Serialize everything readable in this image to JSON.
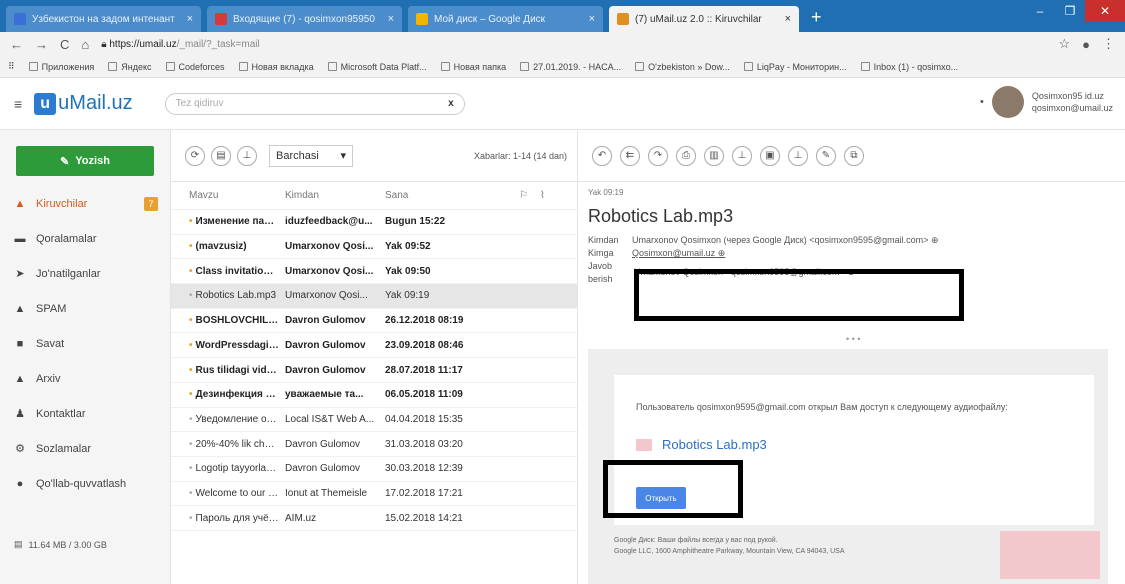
{
  "browser": {
    "tabs": [
      {
        "title": "Ўзбекистон на задом интенант",
        "color": "#3a6fd8"
      },
      {
        "title": "Входящие (7) - qosimxon95950",
        "color": "#d43a3a"
      },
      {
        "title": "Мой диск – Google Диск",
        "color": "#f2b600"
      },
      {
        "title": "(7) uMail.uz 2.0 :: Kiruvchilar",
        "color": "#e09020"
      }
    ],
    "new_tab": "+",
    "url_domain": "https://umail.uz",
    "url_path": "/_mail/?_task=mail",
    "bookmarks": [
      "Приложения",
      "Яндекс",
      "Codeforces",
      "Новая вкладка",
      "Microsoft Data Platf...",
      "Новая папка",
      "27.01.2019. - HACA...",
      "O'zbekiston » Dow...",
      "LiqPay - Мониторин...",
      "Inbox (1) - qosimxo..."
    ]
  },
  "app": {
    "logo_text": "uMail.uz",
    "logo_letter": "u",
    "search_placeholder": "Tez qidiruv",
    "search_clear": "x",
    "user": {
      "line1": "Qosimxon95 id.uz",
      "line2": "qosimxon@umail.uz"
    }
  },
  "sidebar": {
    "compose_label": "Yozish",
    "items": [
      {
        "label": "Kiruvchilar",
        "icon": "inbox-icon",
        "glyph": "▲",
        "badge": "7"
      },
      {
        "label": "Qoralamalar",
        "icon": "drafts-icon",
        "glyph": "▬"
      },
      {
        "label": "Jo'natilganlar",
        "icon": "sent-icon",
        "glyph": "➤"
      },
      {
        "label": "SPAM",
        "icon": "spam-icon",
        "glyph": "▲"
      },
      {
        "label": "Savat",
        "icon": "trash-icon",
        "glyph": "■"
      },
      {
        "label": "Arxiv",
        "icon": "archive-icon",
        "glyph": "▲"
      },
      {
        "label": "Kontaktlar",
        "icon": "contacts-icon",
        "glyph": "♟"
      },
      {
        "label": "Sozlamalar",
        "icon": "settings-icon",
        "glyph": "⚙"
      },
      {
        "label": "Qo'llab-quvvatlash",
        "icon": "support-icon",
        "glyph": "●"
      }
    ],
    "quota": "11.64 MB / 3.00 GB"
  },
  "list": {
    "filter_value": "Barchasi",
    "count_text": "Xabarlar: 1-14 (14 dan)",
    "headers": {
      "subject": "Mavzu",
      "from": "Kimdan",
      "date": "Sana"
    },
    "rows": [
      {
        "subject": "Изменение пароля...",
        "from": "iduzfeedback@u...",
        "date": "Bugun 15:22",
        "unread": true
      },
      {
        "subject": "(mavzusiz)",
        "from": "Umarxonov Qosi...",
        "date": "Yak 09:52",
        "unread": true
      },
      {
        "subject": "Class invitation: \"K...",
        "from": "Umarxonov Qosi...",
        "date": "Yak 09:50",
        "unread": true
      },
      {
        "subject": "Robotics Lab.mp3",
        "from": "Umarxonov Qosi...",
        "date": "Yak 09:19",
        "unread": false,
        "selected": true
      },
      {
        "subject": "BOSHLOVCHILAR ...",
        "from": "Davron Gulomov",
        "date": "26.12.2018 08:19",
        "unread": true
      },
      {
        "subject": "WordPressdagi sa...",
        "from": "Davron Gulomov",
        "date": "23.09.2018 08:46",
        "unread": true
      },
      {
        "subject": "Rus tilidagi video k...",
        "from": "Davron Gulomov",
        "date": "28.07.2018 11:17",
        "unread": true
      },
      {
        "subject": "Дезинфекция в Т...",
        "from": "уважаемые та...",
        "date": "06.05.2018 11:09",
        "unread": true
      },
      {
        "subject": "Уведомление о п...",
        "from": "Local IS&T Web A...",
        "date": "04.04.2018 15:35",
        "unread": false
      },
      {
        "subject": "20%-40% lik chegir...",
        "from": "Davron Gulomov",
        "date": "31.03.2018 03:20",
        "unread": false
      },
      {
        "subject": "Logotip tayyorlash...",
        "from": "Davron Gulomov",
        "date": "30.03.2018 12:39",
        "unread": false
      },
      {
        "subject": "Welcome to our shi...",
        "from": "Ionut at Themeisle",
        "date": "17.02.2018 17:21",
        "unread": false
      },
      {
        "subject": "Пароль для учёт...",
        "from": "AIM.uz",
        "date": "15.02.2018 14:21",
        "unread": false
      }
    ]
  },
  "message": {
    "date": "Yak 09:19",
    "subject": "Robotics Lab.mp3",
    "from_label": "Kimdan",
    "from_value": "Umarxonov Qosimxon (через Google Диск) <qosimxon9595@gmail.com>",
    "to_label": "Kimga",
    "to_value": "Qosimxon@umail.uz",
    "reply_label_1": "Javob",
    "reply_label_2": "berish",
    "reply_value": "Umarxonov Qosimxon <qosimxon9595@gmail.com>",
    "more": "• • •",
    "body_text": "Пользователь qosimxon9595@gmail.com открыл Вам доступ к следующему аудиофайлу:",
    "attachment": "Robotics Lab.mp3",
    "open_button": "Открыть",
    "footer_1": "Google Диск: Ваши файлы всегда у вас под рукой.",
    "footer_2": "Google LLC, 1600 Amphitheatre Parkway, Mountain View, CA 94043, USA"
  }
}
